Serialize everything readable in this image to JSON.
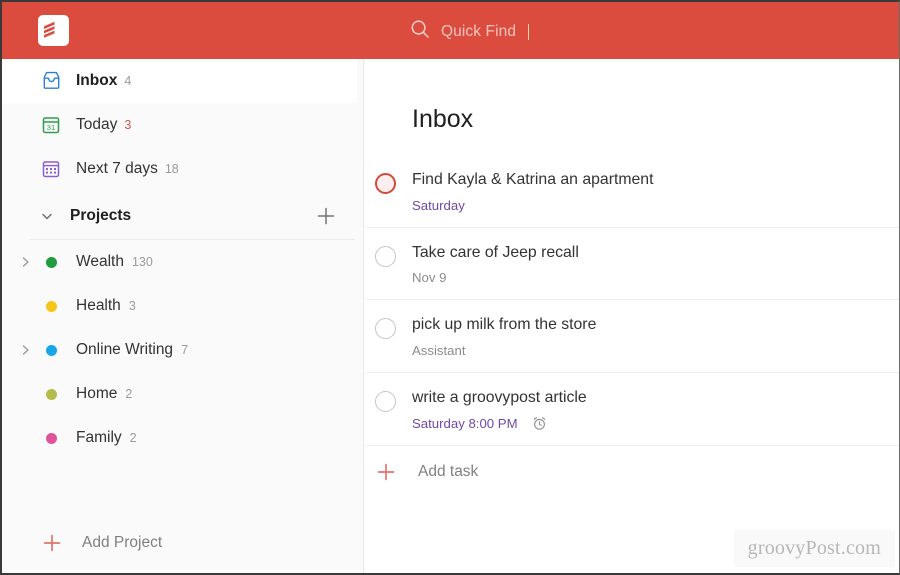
{
  "app": {
    "name": "Todoist",
    "logo_icon": "todoist-logo-icon",
    "brand_color": "#db4c3f"
  },
  "header": {
    "search": {
      "icon": "search-icon",
      "placeholder": "Quick Find",
      "value": ""
    }
  },
  "sidebar": {
    "nav": [
      {
        "label": "Inbox",
        "count": "4",
        "icon": "inbox-icon",
        "selected": true,
        "count_color": "#9a9a9a"
      },
      {
        "label": "Today",
        "count": "3",
        "icon": "calendar-today-icon",
        "selected": false,
        "count_color": "#c9584b"
      },
      {
        "label": "Next 7 days",
        "count": "18",
        "icon": "calendar-week-icon",
        "selected": false,
        "count_color": "#9a9a9a"
      }
    ],
    "projects_section": {
      "title": "Projects",
      "collapse_icon": "chevron-down-icon",
      "add_icon": "plus-icon"
    },
    "projects": [
      {
        "label": "Wealth",
        "count": "130",
        "color": "#1f9d3e",
        "expandable": true
      },
      {
        "label": "Health",
        "count": "3",
        "color": "#f5c517",
        "expandable": false
      },
      {
        "label": "Online Writing",
        "count": "7",
        "color": "#17a6e8",
        "expandable": true
      },
      {
        "label": "Home",
        "count": "2",
        "color": "#b5bd4a",
        "expandable": false
      },
      {
        "label": "Family",
        "count": "2",
        "color": "#e0549b",
        "expandable": false
      }
    ],
    "add_project": {
      "label": "Add Project",
      "icon": "plus-icon"
    }
  },
  "main": {
    "title": "Inbox",
    "tasks": [
      {
        "title": "Find Kayla & Katrina an apartment",
        "meta": "Saturday",
        "meta_type": "due",
        "checkbox_state": "hover",
        "reminder": false
      },
      {
        "title": "Take care of Jeep recall",
        "meta": "Nov 9",
        "meta_type": "plain",
        "checkbox_state": "default",
        "reminder": false
      },
      {
        "title": "pick up milk from the store",
        "meta": "Assistant",
        "meta_type": "plain",
        "checkbox_state": "default",
        "reminder": false
      },
      {
        "title": "write a groovypost article",
        "meta": "Saturday 8:00 PM",
        "meta_type": "due",
        "checkbox_state": "default",
        "reminder": true,
        "reminder_icon": "alarm-clock-icon"
      }
    ],
    "add_task": {
      "label": "Add task",
      "icon": "plus-icon"
    }
  },
  "watermark": {
    "text": "groovyPost.com"
  }
}
